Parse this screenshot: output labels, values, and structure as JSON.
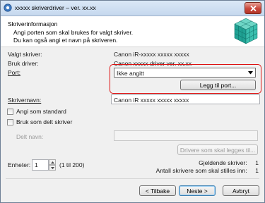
{
  "window": {
    "title": "xxxxx skriverdriver – ver. xx.xx",
    "close_icon": "close-icon"
  },
  "header": {
    "title": "Skriverinformasjon",
    "line1": "Angi porten som skal brukes for valgt skriver.",
    "line2": "Du kan også angi et navn på skriveren.",
    "logo_icon": "printer-driver-cube-icon"
  },
  "info": {
    "valgt_label": "Valgt skriver:",
    "valgt_value": "Canon iR-xxxxx xxxxx xxxxx",
    "driver_label": "Bruk driver:",
    "driver_value": "Canon xxxxx driver ver. xx.xx",
    "port_label": "Port:",
    "port_value": "Ikke angitt",
    "add_port_label": "Legg til port...",
    "name_label": "Skrivernavn:",
    "name_value": "Canon iR xxxxx xxxxx xxxxx"
  },
  "options": {
    "default_label": "Angi som standard",
    "shared_label": "Bruk som delt skriver",
    "share_name_label": "Delt navn:",
    "share_name_value": "",
    "drivers_button": "Drivere som skal legges til..."
  },
  "units": {
    "label": "Enheter:",
    "value": "1",
    "range": "(1 til 200)",
    "current_label": "Gjeldende skriver:",
    "current_value": "1",
    "count_label": "Antall skrivere som skal stilles inn:",
    "count_value": "1"
  },
  "footer": {
    "back": "< Tilbake",
    "next": "Neste >",
    "cancel": "Avbryt"
  },
  "colors": {
    "highlight": "#dd1111",
    "accent": "#3c7fb1"
  }
}
